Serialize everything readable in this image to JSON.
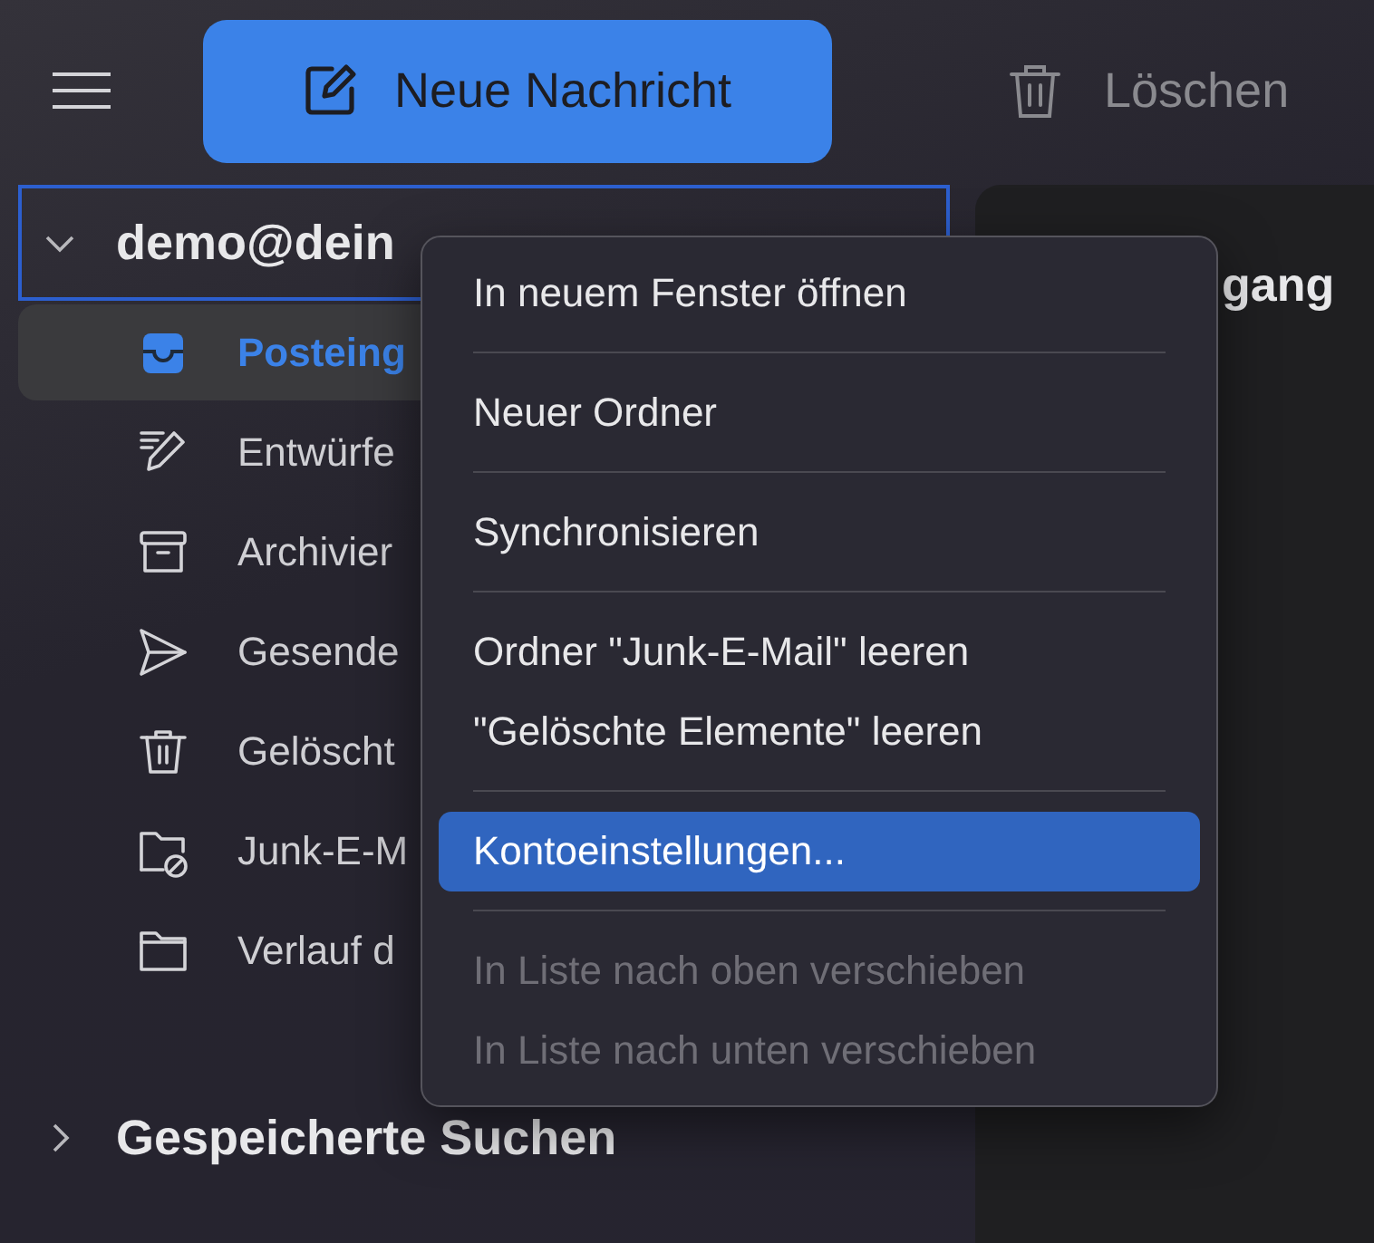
{
  "toolbar": {
    "new_message_button": {
      "label": "Neue Nachricht"
    },
    "delete_button": {
      "label": "Löschen",
      "disabled": true
    }
  },
  "sidebar": {
    "accounts": [
      {
        "name": "demo@dein",
        "expanded": true,
        "focused": true,
        "folders": [
          {
            "label": "Posteing",
            "kind": "inbox",
            "selected": true
          },
          {
            "label": "Entwürfe",
            "kind": "drafts",
            "selected": false
          },
          {
            "label": "Archivier",
            "kind": "archive",
            "selected": false
          },
          {
            "label": "Gesende",
            "kind": "sent",
            "selected": false
          },
          {
            "label": "Gelöscht",
            "kind": "trash",
            "selected": false
          },
          {
            "label": "Junk-E-M",
            "kind": "junk",
            "selected": false
          },
          {
            "label": "Verlauf d",
            "kind": "folder",
            "selected": false
          }
        ]
      },
      {
        "name": "Gespeicherte Suchen",
        "expanded": false,
        "focused": false
      }
    ]
  },
  "message_pane": {
    "title": "gang"
  },
  "context_menu": {
    "groups": [
      [
        {
          "label": "In neuem Fenster öffnen",
          "selected": false,
          "disabled": false
        }
      ],
      [
        {
          "label": "Neuer Ordner",
          "selected": false,
          "disabled": false
        }
      ],
      [
        {
          "label": "Synchronisieren",
          "selected": false,
          "disabled": false
        }
      ],
      [
        {
          "label": "Ordner \"Junk-E-Mail\" leeren",
          "selected": false,
          "disabled": false
        },
        {
          "label": "\"Gelöschte Elemente\" leeren",
          "selected": false,
          "disabled": false
        }
      ],
      [
        {
          "label": "Kontoeinstellungen...",
          "selected": true,
          "disabled": false
        }
      ],
      [
        {
          "label": "In Liste nach oben verschieben",
          "selected": false,
          "disabled": true
        },
        {
          "label": "In Liste nach unten verschieben",
          "selected": false,
          "disabled": true
        }
      ]
    ]
  }
}
